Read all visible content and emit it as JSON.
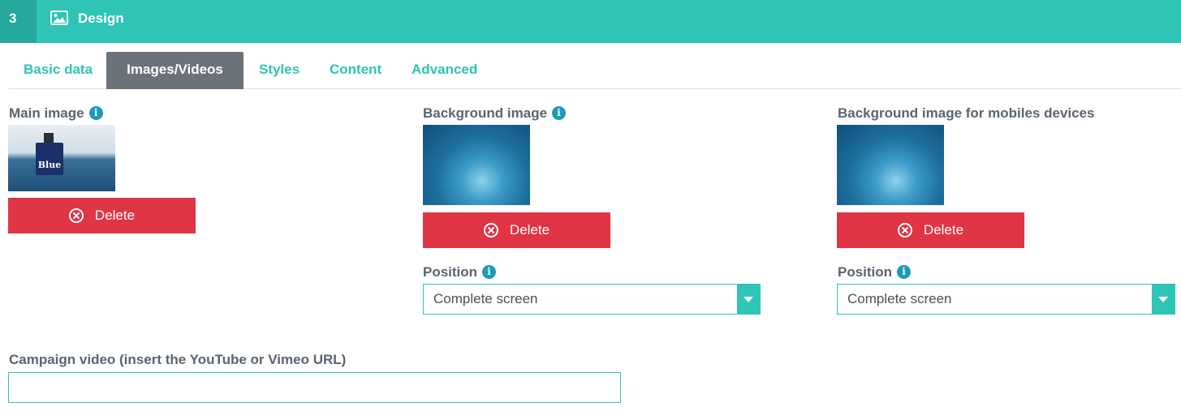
{
  "header": {
    "step_number": "3",
    "title": "Design",
    "icon": "image-icon",
    "colors": {
      "bar": "#2ec4b6",
      "step_bg": "#26a89c"
    }
  },
  "tabs": [
    {
      "label": "Basic data",
      "active": false
    },
    {
      "label": "Images/Videos",
      "active": true
    },
    {
      "label": "Styles",
      "active": false
    },
    {
      "label": "Content",
      "active": false
    },
    {
      "label": "Advanced",
      "active": false
    }
  ],
  "main_image": {
    "label": "Main image",
    "thumbnail_text": "Blue",
    "delete_label": "Delete"
  },
  "background_image": {
    "label": "Background image",
    "delete_label": "Delete",
    "position_label": "Position",
    "position_value": "Complete screen"
  },
  "background_mobile": {
    "label": "Background image for mobiles devices",
    "delete_label": "Delete",
    "position_label": "Position",
    "position_value": "Complete screen"
  },
  "campaign_video": {
    "label": "Campaign video (insert the YouTube or Vimeo URL)",
    "value": ""
  },
  "colors": {
    "accent": "#2ec4b6",
    "danger": "#e03545",
    "active_tab": "#6b727a",
    "info": "#1a9ab8"
  }
}
